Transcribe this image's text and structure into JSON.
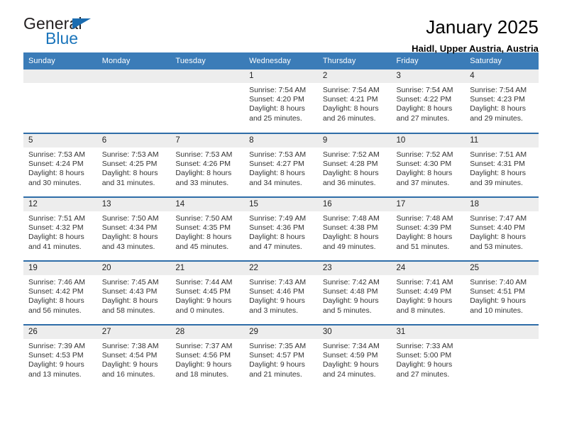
{
  "brand": {
    "name_line1": "General",
    "name_line2": "Blue",
    "flag_icon": "blue-triangle-flag-icon",
    "accent_color": "#1b75bb"
  },
  "header": {
    "title": "January 2025",
    "subtitle": "Haidl, Upper Austria, Austria"
  },
  "theme": {
    "header_row_color": "#3b7cb8",
    "row_divider_color": "#2f6da8",
    "daynum_band_color": "#ededed"
  },
  "weekdays": [
    "Sunday",
    "Monday",
    "Tuesday",
    "Wednesday",
    "Thursday",
    "Friday",
    "Saturday"
  ],
  "labels": {
    "sunrise_prefix": "Sunrise:",
    "sunset_prefix": "Sunset:",
    "daylight_prefix": "Daylight:"
  },
  "weeks": [
    [
      {
        "day": "",
        "sunrise": "",
        "sunset": "",
        "daylight_line1": "",
        "daylight_line2": ""
      },
      {
        "day": "",
        "sunrise": "",
        "sunset": "",
        "daylight_line1": "",
        "daylight_line2": ""
      },
      {
        "day": "",
        "sunrise": "",
        "sunset": "",
        "daylight_line1": "",
        "daylight_line2": ""
      },
      {
        "day": "1",
        "sunrise": "Sunrise: 7:54 AM",
        "sunset": "Sunset: 4:20 PM",
        "daylight_line1": "Daylight: 8 hours",
        "daylight_line2": "and 25 minutes."
      },
      {
        "day": "2",
        "sunrise": "Sunrise: 7:54 AM",
        "sunset": "Sunset: 4:21 PM",
        "daylight_line1": "Daylight: 8 hours",
        "daylight_line2": "and 26 minutes."
      },
      {
        "day": "3",
        "sunrise": "Sunrise: 7:54 AM",
        "sunset": "Sunset: 4:22 PM",
        "daylight_line1": "Daylight: 8 hours",
        "daylight_line2": "and 27 minutes."
      },
      {
        "day": "4",
        "sunrise": "Sunrise: 7:54 AM",
        "sunset": "Sunset: 4:23 PM",
        "daylight_line1": "Daylight: 8 hours",
        "daylight_line2": "and 29 minutes."
      }
    ],
    [
      {
        "day": "5",
        "sunrise": "Sunrise: 7:53 AM",
        "sunset": "Sunset: 4:24 PM",
        "daylight_line1": "Daylight: 8 hours",
        "daylight_line2": "and 30 minutes."
      },
      {
        "day": "6",
        "sunrise": "Sunrise: 7:53 AM",
        "sunset": "Sunset: 4:25 PM",
        "daylight_line1": "Daylight: 8 hours",
        "daylight_line2": "and 31 minutes."
      },
      {
        "day": "7",
        "sunrise": "Sunrise: 7:53 AM",
        "sunset": "Sunset: 4:26 PM",
        "daylight_line1": "Daylight: 8 hours",
        "daylight_line2": "and 33 minutes."
      },
      {
        "day": "8",
        "sunrise": "Sunrise: 7:53 AM",
        "sunset": "Sunset: 4:27 PM",
        "daylight_line1": "Daylight: 8 hours",
        "daylight_line2": "and 34 minutes."
      },
      {
        "day": "9",
        "sunrise": "Sunrise: 7:52 AM",
        "sunset": "Sunset: 4:28 PM",
        "daylight_line1": "Daylight: 8 hours",
        "daylight_line2": "and 36 minutes."
      },
      {
        "day": "10",
        "sunrise": "Sunrise: 7:52 AM",
        "sunset": "Sunset: 4:30 PM",
        "daylight_line1": "Daylight: 8 hours",
        "daylight_line2": "and 37 minutes."
      },
      {
        "day": "11",
        "sunrise": "Sunrise: 7:51 AM",
        "sunset": "Sunset: 4:31 PM",
        "daylight_line1": "Daylight: 8 hours",
        "daylight_line2": "and 39 minutes."
      }
    ],
    [
      {
        "day": "12",
        "sunrise": "Sunrise: 7:51 AM",
        "sunset": "Sunset: 4:32 PM",
        "daylight_line1": "Daylight: 8 hours",
        "daylight_line2": "and 41 minutes."
      },
      {
        "day": "13",
        "sunrise": "Sunrise: 7:50 AM",
        "sunset": "Sunset: 4:34 PM",
        "daylight_line1": "Daylight: 8 hours",
        "daylight_line2": "and 43 minutes."
      },
      {
        "day": "14",
        "sunrise": "Sunrise: 7:50 AM",
        "sunset": "Sunset: 4:35 PM",
        "daylight_line1": "Daylight: 8 hours",
        "daylight_line2": "and 45 minutes."
      },
      {
        "day": "15",
        "sunrise": "Sunrise: 7:49 AM",
        "sunset": "Sunset: 4:36 PM",
        "daylight_line1": "Daylight: 8 hours",
        "daylight_line2": "and 47 minutes."
      },
      {
        "day": "16",
        "sunrise": "Sunrise: 7:48 AM",
        "sunset": "Sunset: 4:38 PM",
        "daylight_line1": "Daylight: 8 hours",
        "daylight_line2": "and 49 minutes."
      },
      {
        "day": "17",
        "sunrise": "Sunrise: 7:48 AM",
        "sunset": "Sunset: 4:39 PM",
        "daylight_line1": "Daylight: 8 hours",
        "daylight_line2": "and 51 minutes."
      },
      {
        "day": "18",
        "sunrise": "Sunrise: 7:47 AM",
        "sunset": "Sunset: 4:40 PM",
        "daylight_line1": "Daylight: 8 hours",
        "daylight_line2": "and 53 minutes."
      }
    ],
    [
      {
        "day": "19",
        "sunrise": "Sunrise: 7:46 AM",
        "sunset": "Sunset: 4:42 PM",
        "daylight_line1": "Daylight: 8 hours",
        "daylight_line2": "and 56 minutes."
      },
      {
        "day": "20",
        "sunrise": "Sunrise: 7:45 AM",
        "sunset": "Sunset: 4:43 PM",
        "daylight_line1": "Daylight: 8 hours",
        "daylight_line2": "and 58 minutes."
      },
      {
        "day": "21",
        "sunrise": "Sunrise: 7:44 AM",
        "sunset": "Sunset: 4:45 PM",
        "daylight_line1": "Daylight: 9 hours",
        "daylight_line2": "and 0 minutes."
      },
      {
        "day": "22",
        "sunrise": "Sunrise: 7:43 AM",
        "sunset": "Sunset: 4:46 PM",
        "daylight_line1": "Daylight: 9 hours",
        "daylight_line2": "and 3 minutes."
      },
      {
        "day": "23",
        "sunrise": "Sunrise: 7:42 AM",
        "sunset": "Sunset: 4:48 PM",
        "daylight_line1": "Daylight: 9 hours",
        "daylight_line2": "and 5 minutes."
      },
      {
        "day": "24",
        "sunrise": "Sunrise: 7:41 AM",
        "sunset": "Sunset: 4:49 PM",
        "daylight_line1": "Daylight: 9 hours",
        "daylight_line2": "and 8 minutes."
      },
      {
        "day": "25",
        "sunrise": "Sunrise: 7:40 AM",
        "sunset": "Sunset: 4:51 PM",
        "daylight_line1": "Daylight: 9 hours",
        "daylight_line2": "and 10 minutes."
      }
    ],
    [
      {
        "day": "26",
        "sunrise": "Sunrise: 7:39 AM",
        "sunset": "Sunset: 4:53 PM",
        "daylight_line1": "Daylight: 9 hours",
        "daylight_line2": "and 13 minutes."
      },
      {
        "day": "27",
        "sunrise": "Sunrise: 7:38 AM",
        "sunset": "Sunset: 4:54 PM",
        "daylight_line1": "Daylight: 9 hours",
        "daylight_line2": "and 16 minutes."
      },
      {
        "day": "28",
        "sunrise": "Sunrise: 7:37 AM",
        "sunset": "Sunset: 4:56 PM",
        "daylight_line1": "Daylight: 9 hours",
        "daylight_line2": "and 18 minutes."
      },
      {
        "day": "29",
        "sunrise": "Sunrise: 7:35 AM",
        "sunset": "Sunset: 4:57 PM",
        "daylight_line1": "Daylight: 9 hours",
        "daylight_line2": "and 21 minutes."
      },
      {
        "day": "30",
        "sunrise": "Sunrise: 7:34 AM",
        "sunset": "Sunset: 4:59 PM",
        "daylight_line1": "Daylight: 9 hours",
        "daylight_line2": "and 24 minutes."
      },
      {
        "day": "31",
        "sunrise": "Sunrise: 7:33 AM",
        "sunset": "Sunset: 5:00 PM",
        "daylight_line1": "Daylight: 9 hours",
        "daylight_line2": "and 27 minutes."
      },
      {
        "day": "",
        "sunrise": "",
        "sunset": "",
        "daylight_line1": "",
        "daylight_line2": ""
      }
    ]
  ]
}
